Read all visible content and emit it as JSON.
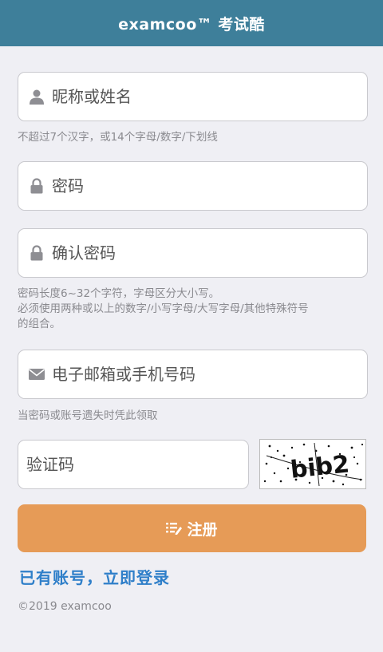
{
  "header": {
    "title": "examcoo™ 考试酷"
  },
  "form": {
    "nickname": {
      "placeholder": "昵称或姓名",
      "value": "",
      "icon": "user-icon"
    },
    "nickname_hint": "不超过7个汉字，或14个字母/数字/下划线",
    "password": {
      "placeholder": "密码",
      "value": "",
      "icon": "lock-icon"
    },
    "confirm_password": {
      "placeholder": "确认密码",
      "value": "",
      "icon": "lock-icon"
    },
    "password_hint": {
      "line1": "密码长度6~32个字符，字母区分大小写。",
      "line2": "必须使用两种或以上的数字/小写字母/大写字母/其他特殊符号",
      "line3": "的组合。"
    },
    "email": {
      "placeholder": "电子邮箱或手机号码",
      "value": "",
      "icon": "envelope-icon"
    },
    "email_hint": "当密码或账号遗失时凭此领取",
    "captcha": {
      "placeholder": "验证码",
      "value": "",
      "image_text": "bib2"
    }
  },
  "actions": {
    "register_label": "注册",
    "register_icon": "form-icon",
    "login_link": "已有账号，立即登录"
  },
  "footer": {
    "copyright": "©2019 examcoo"
  },
  "colors": {
    "header_bg": "#3e7f9a",
    "button_bg": "#e69b57",
    "link": "#2f7fc9",
    "background": "#efeff4"
  }
}
